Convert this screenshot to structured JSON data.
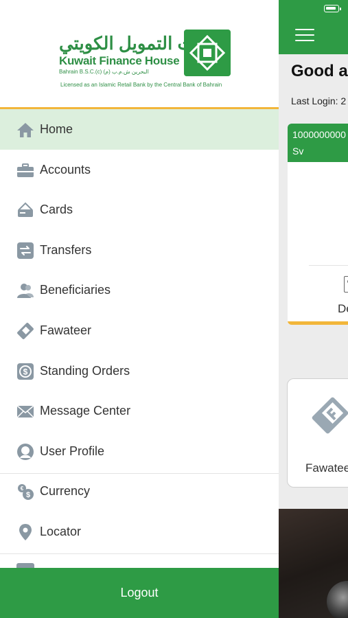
{
  "brand": {
    "name_ar": "بيت التمويل الكويتي",
    "name_en": "Kuwait Finance House",
    "subtitle": "Bahrain B.S.C.(c) البحرين ش.م.ب (م)",
    "license": "Licensed as an Islamic Retail Bank by the Central Bank of Bahrain",
    "color": "#2e9b45",
    "accent": "#f2b63a"
  },
  "menu": {
    "items": [
      {
        "label": "Home",
        "icon": "home-icon",
        "active": true
      },
      {
        "label": "Accounts",
        "icon": "briefcase-icon"
      },
      {
        "label": "Cards",
        "icon": "card-icon"
      },
      {
        "label": "Transfers",
        "icon": "transfer-icon"
      },
      {
        "label": "Beneficiaries",
        "icon": "people-icon"
      },
      {
        "label": "Fawateer",
        "icon": "tag-icon"
      },
      {
        "label": "Standing Orders",
        "icon": "dollar-cycle-icon"
      },
      {
        "label": "Message Center",
        "icon": "mail-icon"
      },
      {
        "label": "User Profile",
        "icon": "user-icon"
      },
      {
        "label": "Currency",
        "icon": "currency-icon"
      },
      {
        "label": "Locator",
        "icon": "location-pin-icon"
      }
    ],
    "logout_label": "Logout"
  },
  "home": {
    "greeting": "Good af",
    "last_login": "Last Login: 2",
    "account_number": "1000000000",
    "account_type": "Sv",
    "details_label": "Det",
    "fawateer_label": "Fawatee"
  }
}
